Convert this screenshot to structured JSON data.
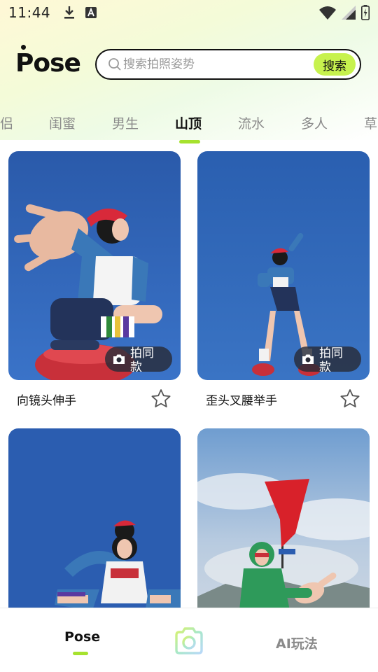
{
  "status_bar": {
    "time": "11:44",
    "icons": [
      "download-icon",
      "font-a-icon",
      "wifi-icon",
      "signal-icon",
      "battery-charging-icon"
    ]
  },
  "header": {
    "logo": "Pose",
    "search_placeholder": "搜索拍照姿势",
    "search_button": "搜索"
  },
  "tabs": {
    "items": [
      "侣",
      "闺蜜",
      "男生",
      "山顶",
      "流水",
      "多人",
      "草"
    ],
    "active_index": 3
  },
  "cards": [
    {
      "title": "向镜头伸手",
      "same_pose_label": "拍同款",
      "favorited": false
    },
    {
      "title": "歪头叉腰举手",
      "same_pose_label": "拍同款",
      "favorited": false
    },
    {
      "title": "",
      "same_pose_label": "",
      "favorited": false
    },
    {
      "title": "",
      "same_pose_label": "",
      "favorited": false
    }
  ],
  "bottom_nav": {
    "items": [
      {
        "label": "Pose",
        "active": true
      },
      {
        "label": "",
        "icon": "camera-icon"
      },
      {
        "label": "AI玩法",
        "active": false
      }
    ]
  },
  "colors": {
    "accent": "#c7f24e",
    "indicator": "#a6e22e",
    "sky_blue": "#2f62b6"
  }
}
